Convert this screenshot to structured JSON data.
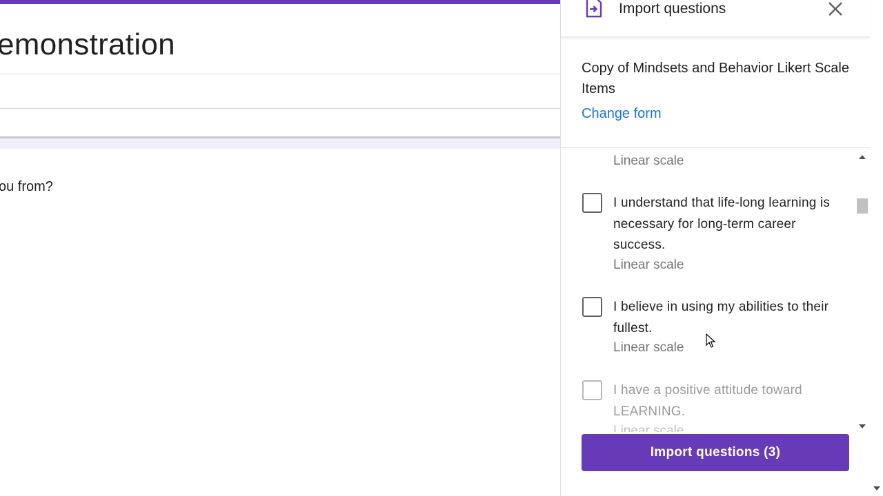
{
  "form_editor": {
    "title_partial": "emonstration",
    "question_partial": "ou from?"
  },
  "import_panel": {
    "title": "Import questions",
    "source_form_name": "Copy of Mindsets and Behavior Likert Scale Items",
    "change_form_label": "Change form",
    "items": [
      {
        "type": "Linear scale"
      },
      {
        "text": "I understand that life-long learning is necessary for long-term career success.",
        "type": "Linear scale",
        "checked": false
      },
      {
        "text": "I believe in using my abilities to their fullest.",
        "type": "Linear scale",
        "checked": false
      },
      {
        "text": "I have a positive attitude toward LEARNING.",
        "type": "Linear scale",
        "checked": false
      }
    ],
    "import_button_label": "Import questions (3)"
  },
  "icons": [
    "import-file-icon",
    "close-icon",
    "scroll-up-arrow-icon",
    "scroll-down-arrow-icon",
    "mouse-cursor-icon"
  ],
  "colors": {
    "accent": "#673ab7",
    "link": "#1a73e8",
    "text": "#202124",
    "muted": "#757575"
  }
}
